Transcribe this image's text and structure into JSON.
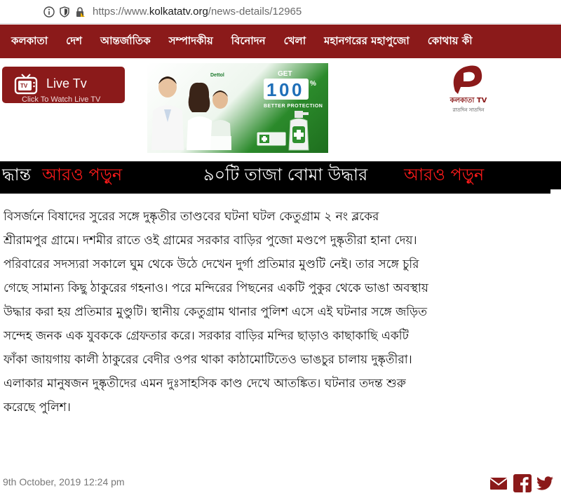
{
  "browser": {
    "url_prefix": "https://www.",
    "url_domain": "kolkatatv.org",
    "url_path": "/news-details/12965",
    "icons": [
      "info-icon",
      "tracking-shield-icon",
      "insecure-lock-icon"
    ]
  },
  "nav": {
    "items": [
      "কলকাতা",
      "দেশ",
      "আন্তর্জাতিক",
      "সম্পাদকীয়",
      "বিনোদন",
      "খেলা",
      "মহানগরের মহাপুজো",
      "কোথায় কী"
    ]
  },
  "live_tv": {
    "title": "Live Tv",
    "subtitle": "Click To Watch Live TV"
  },
  "ad": {
    "brand": "Dettol",
    "get": "GET",
    "percent_digits": [
      "1",
      "0",
      "0"
    ],
    "percent_sign": "%",
    "tagline": "BETTER PROTECTION"
  },
  "logo": {
    "name": "কলকাতা TV",
    "tagline": "রাতদিন সাতদিন"
  },
  "ticker": {
    "segments": [
      {
        "text": "দ্ধান্ত",
        "color": "white"
      },
      {
        "text": "আরও পড়ুন",
        "color": "red"
      },
      {
        "text": "৯০টি তাজা বোমা উদ্ধার",
        "color": "white"
      },
      {
        "text": "আরও পড়ুন",
        "color": "red"
      }
    ]
  },
  "article": {
    "lines": [
      "বিসর্জনে বিষাদের সুরের সঙ্গে দুষ্কৃতীর তাণ্ডবের ঘটনা ঘটল কেতুগ্রাম ২ নং ব্লকের",
      "শ্রীরামপুর গ্রামে।  দশমীর রাতে ওই গ্রামের সরকার বাড়ির পুজো মণ্ডপে দুষ্কৃতীরা হানা দেয়।",
      "পরিবারের সদস্যরা সকালে ঘুম থেকে উঠে দেখেন দুর্গা প্রতিমার মুণ্ডটি নেই। তার সঙ্গে চুরি",
      "গেছে সামান্য কিছু ঠাকুরের গহনাও। পরে মন্দিরের পিছনের একটি পুকুর থেকে ভাঙা অবস্থায়",
      "উদ্ধার করা হয় প্রতিমার মুণ্ডুটি। স্থানীয় কেতুগ্রাম থানার পুলিশ এসে এই ঘটনার সঙ্গে জড়িত",
      "সন্দেহ জনক এক যুবককে গ্রেফতার করে। সরকার বাড়ির মন্দির ছাড়াও কাছাকাছি একটি",
      "ফাঁকা জায়গায় কালী ঠাকুরের বেদীর ওপর থাকা কাঠামোটিতেও ভাঙচুর চালায় দুষ্কৃতীরা।",
      "এলাকার মানুষজন দুষ্কৃতীদের এমন দুঃসাহসিক কাণ্ড দেখে আতঙ্কিত। ঘটনার তদন্ত শুরু",
      "করেছে পুলিশ।"
    ]
  },
  "footer": {
    "date": "9th October, 2019 12:24 pm",
    "share_icons": [
      "mail-icon",
      "facebook-icon",
      "twitter-icon"
    ],
    "share_color": "#8b1a1a"
  },
  "colors": {
    "brand": "#8b1a1a",
    "ticker_red": "#ff1a1a"
  }
}
